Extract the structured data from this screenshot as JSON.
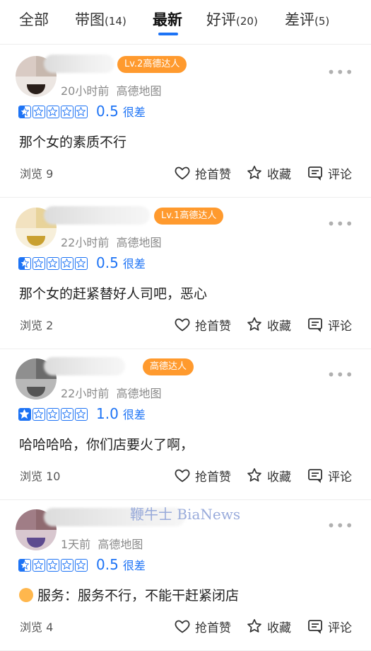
{
  "tabs": [
    {
      "label": "全部",
      "count": ""
    },
    {
      "label": "带图",
      "count": "(14)"
    },
    {
      "label": "最新",
      "count": ""
    },
    {
      "label": "好评",
      "count": "(20)"
    },
    {
      "label": "差评",
      "count": "(5)"
    }
  ],
  "active_tab": "最新",
  "watermark": "鞭牛士 BiaNews",
  "actions": {
    "like": "抢首赞",
    "favorite": "收藏",
    "comment": "评论"
  },
  "reviews": [
    {
      "badge": "Lv.2高德达人",
      "time": "20小时前",
      "source": "高德地图",
      "rating": 0.5,
      "score": "0.5",
      "level": "很差",
      "text": "那个女的素质不行",
      "views": "浏览 9"
    },
    {
      "badge": "Lv.1高德达人",
      "time": "22小时前",
      "source": "高德地图",
      "rating": 0.5,
      "score": "0.5",
      "level": "很差",
      "text": "那个女的赶紧替好人司吧，恶心",
      "views": "浏览 2"
    },
    {
      "badge": "高德达人",
      "time": "22小时前",
      "source": "高德地图",
      "rating": 1.0,
      "score": "1.0",
      "level": "很差",
      "text": "哈哈哈哈，你们店要火了啊，",
      "views": "浏览 10"
    },
    {
      "badge": "",
      "time": "1天前",
      "source": "高德地图",
      "rating": 0.5,
      "score": "0.5",
      "level": "很差",
      "text": "服务：服务不行，不能干赶紧闭店",
      "views": "浏览 4"
    }
  ],
  "colors": {
    "accent": "#1d73f5",
    "badge": "#ff9a2e"
  }
}
